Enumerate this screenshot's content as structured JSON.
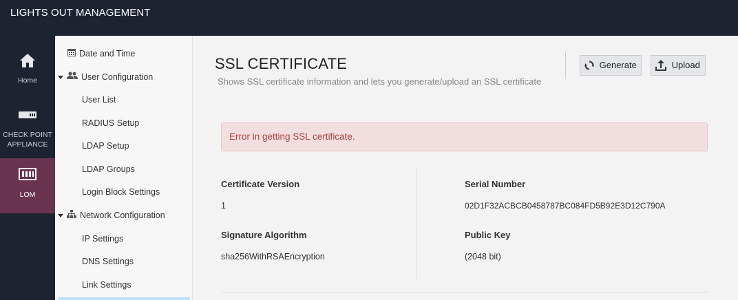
{
  "header": {
    "title": "LIGHTS OUT MANAGEMENT"
  },
  "nav": {
    "items": [
      {
        "label": "Home",
        "icon": "home-icon"
      },
      {
        "label": "CHECK POINT APPLIANCE",
        "line1": "CHECK POINT",
        "line2": "APPLIANCE",
        "icon": "appliance-icon"
      },
      {
        "label": "LOM",
        "icon": "lom-icon",
        "active": true
      }
    ]
  },
  "subnav": {
    "items": [
      {
        "label": "Date and Time",
        "type": "item",
        "icon": "calendar-icon"
      },
      {
        "label": "User Configuration",
        "type": "group",
        "icon": "users-icon"
      },
      {
        "label": "User List",
        "type": "child"
      },
      {
        "label": "RADIUS Setup",
        "type": "child"
      },
      {
        "label": "LDAP Setup",
        "type": "child"
      },
      {
        "label": "LDAP Groups",
        "type": "child"
      },
      {
        "label": "Login Block Settings",
        "type": "child"
      },
      {
        "label": "Network Configuration",
        "type": "group",
        "icon": "network-icon"
      },
      {
        "label": "IP Settings",
        "type": "child"
      },
      {
        "label": "DNS Settings",
        "type": "child"
      },
      {
        "label": "Link Settings",
        "type": "child"
      }
    ]
  },
  "page": {
    "title": "SSL CERTIFICATE",
    "subtitle": "Shows SSL certificate information and lets you generate/upload an SSL certificate",
    "generate_label": "Generate",
    "upload_label": "Upload",
    "error": "Error in getting SSL certificate."
  },
  "certificate": {
    "version_label": "Certificate Version",
    "version_value": "1",
    "serial_label": "Serial Number",
    "serial_value": "02D1F32ACBCB0458787BC084FD5B92E3D12C790A",
    "algorithm_label": "Signature Algorithm",
    "algorithm_value": "sha256WithRSAEncryption",
    "pubkey_label": "Public Key",
    "pubkey_value": "(2048 bit)"
  },
  "colors": {
    "header_bg": "#1d2331",
    "active_nav_bg": "#6a3450",
    "alert_bg": "#f2dede",
    "alert_text": "#a94442"
  }
}
